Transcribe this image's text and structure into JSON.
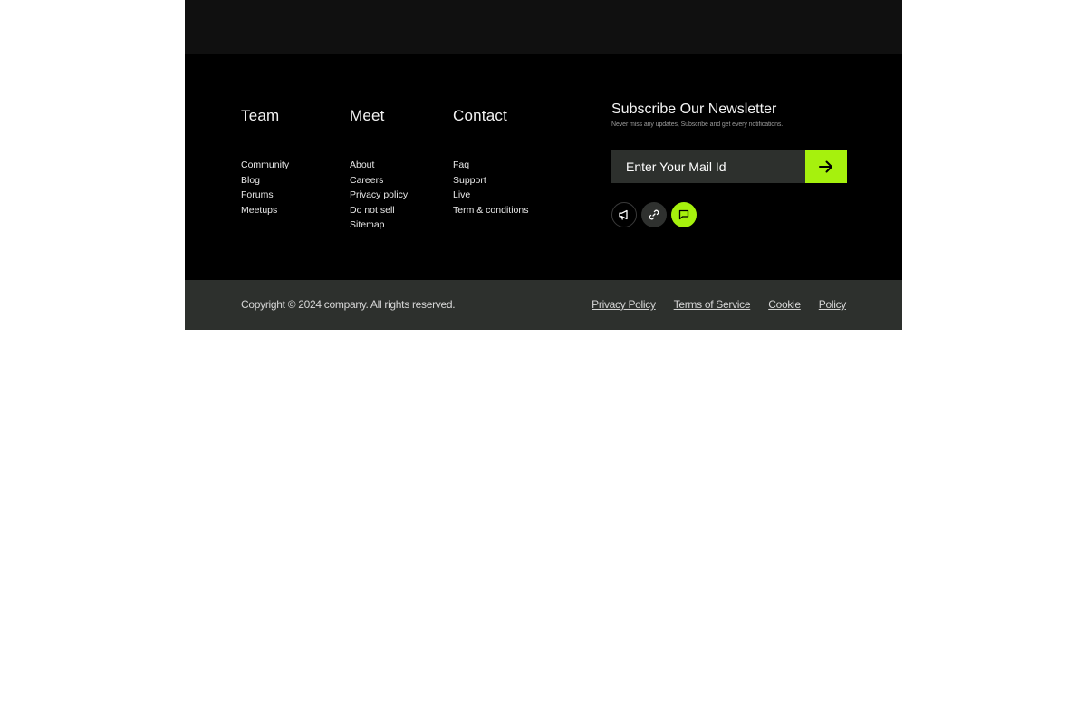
{
  "columns": [
    {
      "title": "Team",
      "links": [
        "Community",
        "Blog",
        "Forums",
        "Meetups"
      ]
    },
    {
      "title": "Meet",
      "links": [
        "About",
        "Careers",
        "Privacy policy",
        "Do not sell",
        "Sitemap"
      ]
    },
    {
      "title": "Contact",
      "links": [
        "Faq",
        "Support",
        "Live",
        "Term & conditions"
      ]
    }
  ],
  "newsletter": {
    "title": "Subscribe Our Newsletter",
    "subtitle": "Never miss any updates, Subscribe and get every notifications.",
    "placeholder": "Enter Your Mail Id",
    "submit_icon": "arrow-right-icon"
  },
  "socials": [
    {
      "icon": "megaphone-icon"
    },
    {
      "icon": "link-icon"
    },
    {
      "icon": "chat-icon"
    }
  ],
  "footer": {
    "copyright": "Copyright © 2024  company. All rights reserved.",
    "links": [
      "Privacy Policy",
      "Terms of Service",
      "Cookie",
      "Policy"
    ]
  },
  "colors": {
    "accent": "#a6f10d",
    "background": "#000000",
    "top_band": "#101010",
    "bottom_bar": "#2d302d"
  }
}
